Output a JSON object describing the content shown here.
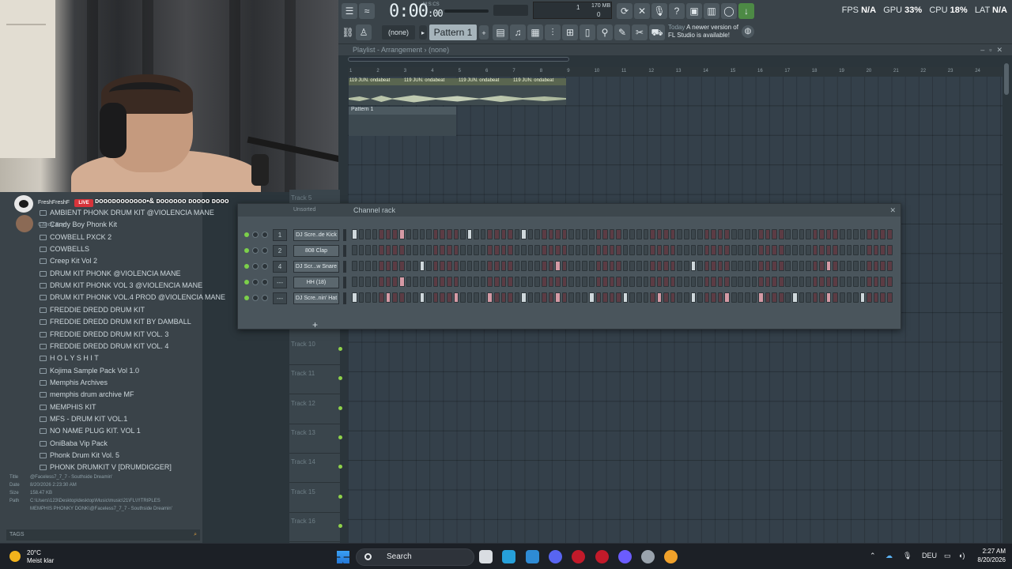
{
  "toolbar": {
    "time": "0:00",
    "time_frac": ":00",
    "mscs": "M:S:CS",
    "memory": "170 MB",
    "meter_top": "1",
    "meter_bottom": "0",
    "fps_label": "FPS",
    "fps_value": "N/A",
    "gpu_label": "GPU",
    "gpu_value": "33%",
    "cpu_label": "CPU",
    "cpu_value": "18%",
    "lat_label": "LAT",
    "lat_value": "N/A",
    "pattern_select": "(none)",
    "pattern_name": "Pattern 1",
    "news_when": "Today",
    "news_text": "A newer version of FL Studio is available!"
  },
  "playlist": {
    "title": "Playlist - Arrangement",
    "subtitle": "(none)",
    "bar_numbers": [
      "1",
      "2",
      "3",
      "4",
      "5",
      "6",
      "7",
      "8",
      "9",
      "10",
      "11",
      "12",
      "13",
      "14",
      "15",
      "16",
      "17",
      "18",
      "19",
      "20",
      "21",
      "22",
      "23",
      "24"
    ],
    "audio_clip_labels": [
      "119 JUN. ondabeat",
      "119 JUN. ondabeat",
      "119 JUN. ondabeat",
      "119 JUN. ondabeat"
    ],
    "pattern_clip_label": "Pattern 1",
    "tracks": [
      "Track 5",
      "Track 10",
      "Track 11",
      "Track 12",
      "Track 13",
      "Track 14",
      "Track 15",
      "Track 16"
    ]
  },
  "channel_rack": {
    "title": "Channel rack",
    "filter": "Unsorted",
    "add_label": "+",
    "channels": [
      {
        "num": "1",
        "name": "DJ Scre..de Kick",
        "on": [
          0,
          7,
          17,
          25
        ]
      },
      {
        "num": "2",
        "name": "808 Clap",
        "on": []
      },
      {
        "num": "4",
        "name": "DJ Scr...w Snare",
        "on": [
          10,
          30,
          50,
          70
        ]
      },
      {
        "num": "---",
        "name": "HH (18)",
        "on": [
          7
        ]
      },
      {
        "num": "---",
        "name": "DJ Scre..nin' Hat",
        "on": [
          0,
          5,
          10,
          15,
          20,
          25,
          30,
          35,
          40,
          45,
          50,
          55,
          60,
          65,
          70,
          75
        ]
      }
    ]
  },
  "stream": {
    "channel_name": "FreshFreshF",
    "live_label": "LIVE",
    "stream_title": "ᴅᴏᴏᴏᴅᴏᴏᴏᴏᴏᴏᴏ•& ᴅᴏᴏᴏᴏᴏᴏ ᴅᴏᴏᴏᴏ ᴅᴏᴏᴏ",
    "second_name": "Candy Boy"
  },
  "browser": {
    "items": [
      "AMBIENT PHONK DRUM KIT @VIOLENCIA MANE",
      "Candy Boy Phonk Kit",
      "COWBELL PXCK 2",
      "COWBELLS",
      "Creep Kit Vol 2",
      "DRUM KIT PHONK @VIOLENCIA MANE",
      "DRUM KIT PHONK VOL 3 @VIOLENCIA MANE",
      "DRUM KIT PHONK VOL.4 PROD @VIOLENCIA MANE",
      "FREDDIE DREDD DRUM KIT",
      "FREDDIE DREDD DRUM KIT BY DAMBALL",
      "FREDDIE DREDD DRUM KIT VOL. 3",
      "FREDDIE DREDD DRUM KIT VOL. 4",
      "H O L Y S H I T",
      "Kojima Sample Pack Vol 1.0",
      "Memphis Archives",
      "memphis drum archive MF",
      "MEMPHIS KIT",
      "MFS - DRUM KIT VOL.1",
      "NO NAME PLUG KIT. VOL 1",
      "OniBaba Vip Pack",
      "Phonk Drum Kit Vol. 5",
      "PHONK DRUMKIT V [DRUMDIGGER]"
    ],
    "info": {
      "title_k": "Title",
      "title_v": "@Faceless7_7_7 - Southside Dreamin'",
      "date_k": "Date",
      "date_v": "8/20/2026 2:23:30 AM",
      "size_k": "Size",
      "size_v": "158.47 KB",
      "path_k": "Path",
      "path_v": "C:\\Users\\123\\Desktop\\desktop\\Music\\music\\21\\FL\\!!!TRIPLES",
      "path_v2": "MEMPHIS PHONKY DONK\\@Faceless7_7_7 - Southside Dreamin'"
    },
    "tags_label": "TAGS"
  },
  "taskbar": {
    "temperature": "20°C",
    "weather": "Meist klar",
    "search_label": "Search",
    "language": "DEU",
    "clock_time": "2:27 AM",
    "clock_date": "8/20/2026",
    "app_colors": [
      "#d9dde2",
      "#26a0da",
      "#2e8bd5",
      "#5865f2",
      "#c21a2a",
      "#c21a2a",
      "#6b5cff",
      "#9aa3ad",
      "#f0a12a"
    ]
  }
}
